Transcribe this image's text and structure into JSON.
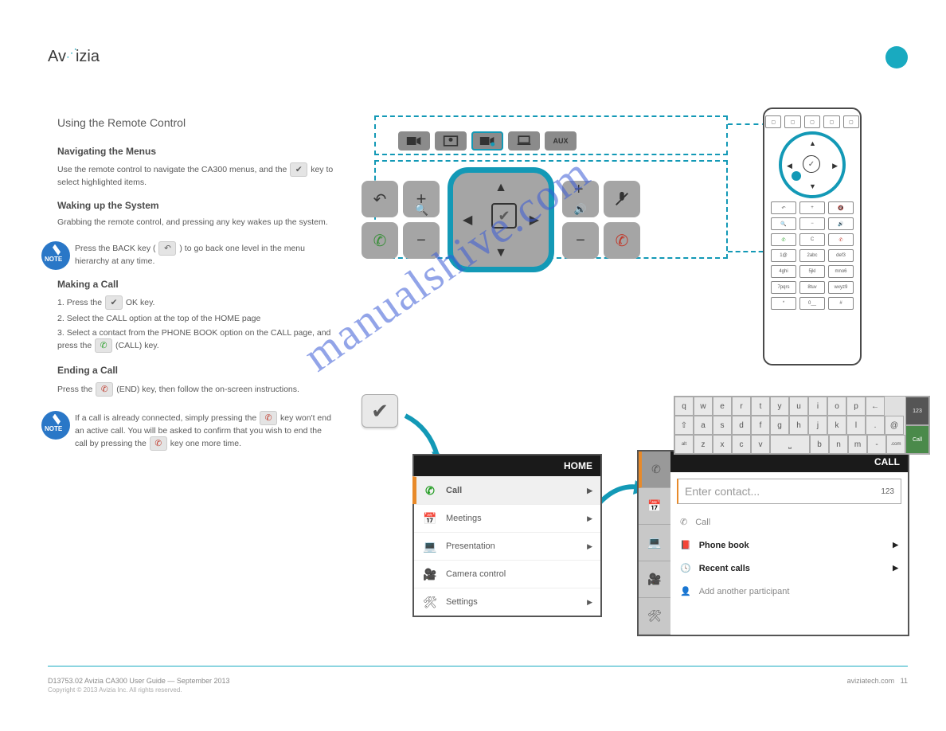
{
  "brand": "Avizia",
  "left": {
    "title": "Using the Remote Control",
    "sub1": "Navigating the Menus",
    "p1a": "Use the remote control to navigate the CA300 menus, and the",
    "p1b": "key to select highlighted items.",
    "sub2": "Waking up the System",
    "p2": "Grabbing the remote control, and pressing any key wakes up the system.",
    "note1title": "NOTE",
    "note1": "Press the BACK key (",
    "note1b": ") to go back one level in the menu hierarchy at any time.",
    "sub3": "Making a Call",
    "call_steps": {
      "step1a": "Press the ",
      "step1b": " OK key.",
      "step2": "Select the CALL option at the top of the HOME page",
      "step3a": "Select a contact from the PHONE BOOK option on the CALL page, and press the ",
      "step3b": " (CALL) key."
    },
    "sub4": "Ending a Call",
    "end_p1a": "Press the ",
    "end_p1b": " (END) key, then follow the on-screen instructions.",
    "note2a": "If a call is already connected, simply pressing the ",
    "note2b": " key won't end an active call. You will be asked to confirm that you wish to end the call by pressing the",
    "note2c": " key one more time."
  },
  "home_menu": {
    "title": "HOME",
    "items": [
      "Call",
      "Meetings",
      "Presentation",
      "Camera control",
      "Settings"
    ]
  },
  "call_panel": {
    "title": "CALL",
    "placeholder": "Enter contact...",
    "mode": "123",
    "rows": [
      "Call",
      "Phone book",
      "Recent calls",
      "Add another participant"
    ]
  },
  "keyboard": {
    "rows": [
      [
        "q",
        "w",
        "e",
        "r",
        "t",
        "y",
        "u",
        "i",
        "o",
        "p"
      ],
      [
        "a",
        "s",
        "d",
        "f",
        "g",
        "h",
        "j",
        "k",
        "l",
        "."
      ],
      [
        "z",
        "x",
        "c",
        "v",
        " ",
        "b",
        "n",
        "m",
        "-"
      ]
    ],
    "side_top": [
      "←",
      "⌫"
    ],
    "side_mid": [
      "@",
      ".com"
    ],
    "dark_top": "123",
    "dark_bot": "Call"
  },
  "remote_keys": {
    "row3": [
      "1@",
      "2abc",
      "def3"
    ],
    "row4": [
      "4ghi",
      "5jkl",
      "mno6"
    ],
    "row5": [
      "7pqrs",
      "8tuv",
      "wxyz9"
    ],
    "row6": [
      "*",
      "0__",
      "#"
    ],
    "row_call": [
      "✆",
      "C",
      "✆"
    ]
  },
  "aux_label": "AUX",
  "watermark": "manualshive.com",
  "footer": {
    "doc": "D13753.02   Avizia CA300 User Guide — September 2013",
    "copy": "Copyright © 2013 Avizia Inc. All rights reserved.",
    "site": "aviziatech.com",
    "page": "11"
  }
}
